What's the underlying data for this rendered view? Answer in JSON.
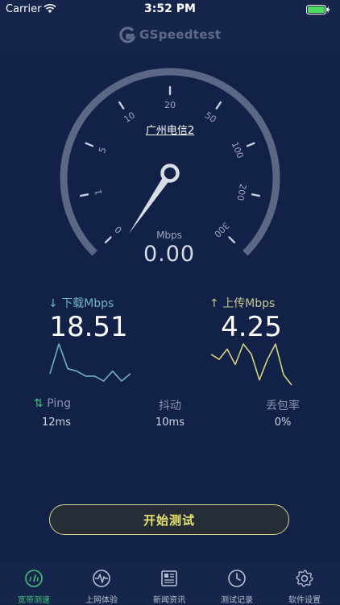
{
  "status_bar": {
    "carrier": "Carrier",
    "time": "3:52 PM"
  },
  "header": {
    "logo_text": "GSpeedtest"
  },
  "gauge": {
    "server": "广州电信2",
    "unit": "Mbps",
    "value": "0.00",
    "ticks": [
      "0",
      "1",
      "5",
      "10",
      "20",
      "50",
      "100",
      "200",
      "300"
    ]
  },
  "download": {
    "label": "下载Mbps",
    "value": "18.51",
    "samples": [
      4,
      16,
      6,
      5,
      3,
      3,
      1,
      5,
      1,
      4
    ]
  },
  "upload": {
    "label": "上传Mbps",
    "value": "4.25",
    "samples": [
      9,
      8,
      10,
      7,
      11,
      9,
      4,
      8,
      11,
      5,
      3
    ]
  },
  "stats": [
    {
      "label": "Ping",
      "value": "12ms"
    },
    {
      "label": "抖动",
      "value": "10ms"
    },
    {
      "label": "丢包率",
      "value": "0%"
    }
  ],
  "start_button": {
    "label": "开始测试"
  },
  "tabs": [
    {
      "label": "宽带测速",
      "icon": "speedometer-icon",
      "active": true
    },
    {
      "label": "上网体验",
      "icon": "pulse-icon",
      "active": false
    },
    {
      "label": "新闻资讯",
      "icon": "newspaper-icon",
      "active": false
    },
    {
      "label": "测试记录",
      "icon": "clock-icon",
      "active": false
    },
    {
      "label": "软件设置",
      "icon": "gear-icon",
      "active": false
    }
  ],
  "colors": {
    "background": "#112148",
    "accent_green": "#43c07a",
    "download_line": "#6fb3c7",
    "upload_line": "#d8d17a",
    "button_border": "#d2d28a"
  }
}
